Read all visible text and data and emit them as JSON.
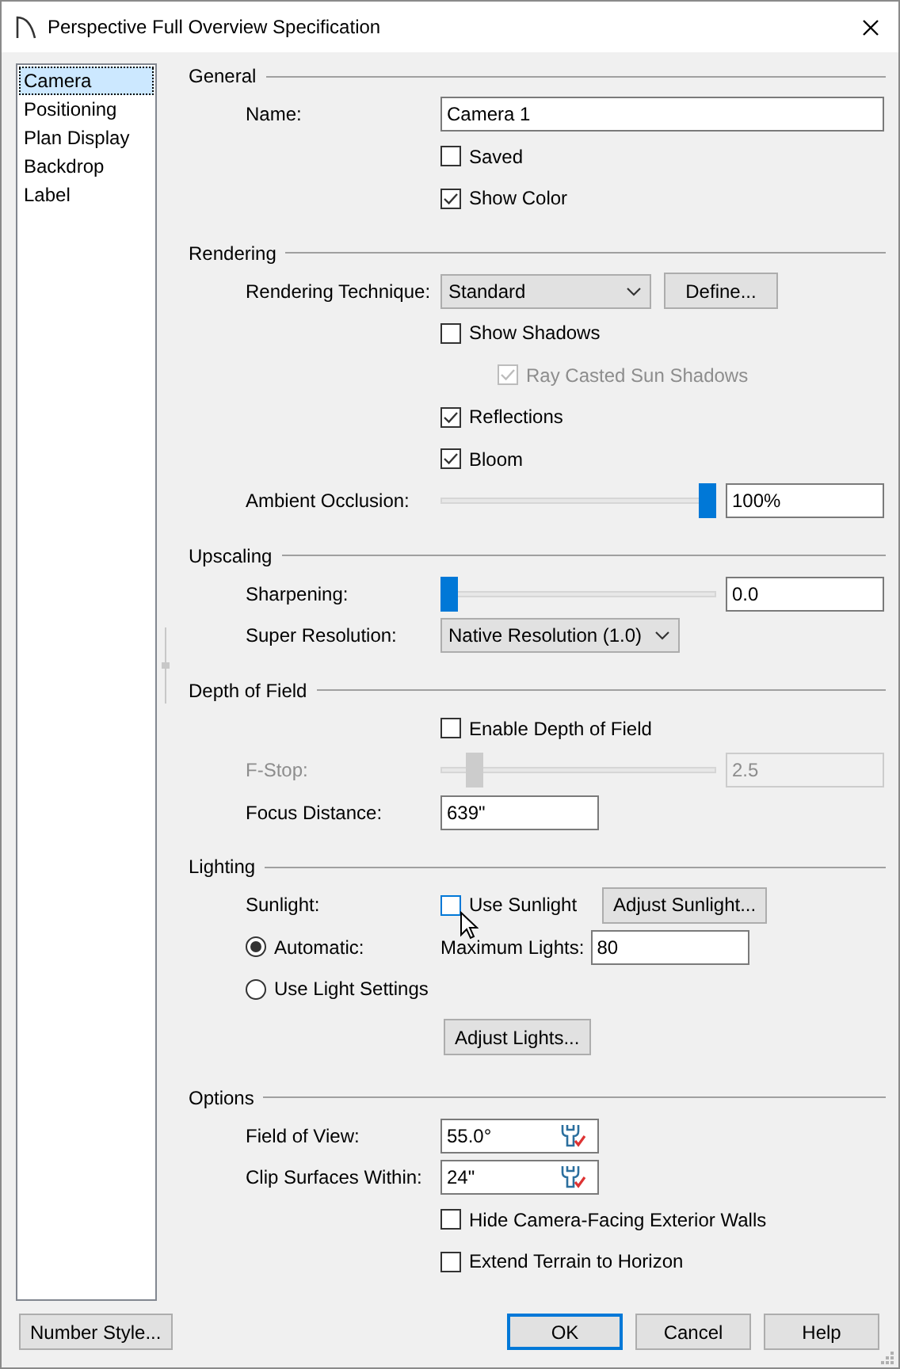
{
  "window": {
    "title": "Perspective Full Overview Specification"
  },
  "sidebar": {
    "items": [
      {
        "label": "Camera",
        "selected": true
      },
      {
        "label": "Positioning",
        "selected": false
      },
      {
        "label": "Plan Display",
        "selected": false
      },
      {
        "label": "Backdrop",
        "selected": false
      },
      {
        "label": "Label",
        "selected": false
      }
    ]
  },
  "sections": [
    {
      "heading": "General",
      "rows": [
        {
          "kind": "longfield",
          "label": "Name:",
          "value": "Camera 1"
        },
        {
          "kind": "checkbox",
          "label": "Saved",
          "checked": false
        },
        {
          "kind": "checkbox",
          "label": "Show Color",
          "checked": true
        }
      ]
    },
    {
      "heading": "Rendering",
      "rows": [
        {
          "kind": "select",
          "label": "Rendering Technique:",
          "value": "Standard",
          "button": "Define..."
        },
        {
          "kind": "checkbox",
          "label": "Show Shadows",
          "checked": false
        },
        {
          "kind": "subcheckbox",
          "label": "Ray Casted Sun Shadows",
          "checked": true,
          "disabled": true
        },
        {
          "kind": "checkbox",
          "label": "Reflections",
          "checked": true
        },
        {
          "kind": "checkbox",
          "label": "Bloom",
          "checked": true
        },
        {
          "kind": "slider",
          "label": "Ambient Occlusion:",
          "level": 1,
          "value": "100%"
        }
      ]
    },
    {
      "heading": "Upscaling",
      "rows": [
        {
          "kind": "slider",
          "label": "Sharpening:",
          "level": 0,
          "value": "0.0"
        },
        {
          "kind": "select",
          "label": "Super Resolution:",
          "value": "Native Resolution (1.0)"
        }
      ]
    },
    {
      "heading": "Depth of Field",
      "rows": [
        {
          "kind": "checkbox",
          "label": "Enable Depth of Field",
          "checked": false
        },
        {
          "kind": "slider",
          "label": "F-Stop:",
          "level": 0.1,
          "value": "2.5",
          "disabled": true
        },
        {
          "kind": "field",
          "label": "Focus Distance:",
          "value": "639\""
        }
      ]
    },
    {
      "heading": "Lighting",
      "rows": [
        {
          "kind": "sunlight",
          "label": "Sunlight:",
          "checkbox_label": "Use Sunlight",
          "checked": false,
          "hovered": true,
          "button": "Adjust Sunlight..."
        },
        {
          "kind": "radio",
          "label": "Automatic:",
          "selected": true,
          "field_label": "Maximum Lights:",
          "field_value": "80"
        },
        {
          "kind": "radio",
          "label": "Use Light Settings",
          "selected": false
        },
        {
          "kind": "button",
          "label": "Adjust Lights..."
        }
      ]
    },
    {
      "heading": "Options",
      "rows": [
        {
          "kind": "toolfield",
          "label": "Field of View:",
          "value": "55.0°"
        },
        {
          "kind": "toolfield",
          "label": "Clip Surfaces Within:",
          "value": "24\""
        },
        {
          "kind": "checkbox",
          "label": "Hide Camera-Facing Exterior Walls",
          "checked": false
        },
        {
          "kind": "checkbox",
          "label": "Extend Terrain to Horizon",
          "checked": false
        }
      ]
    }
  ],
  "footer": {
    "left_button": "Number Style...",
    "buttons": [
      {
        "label": "OK",
        "default": true
      },
      {
        "label": "Cancel",
        "default": false
      },
      {
        "label": "Help",
        "default": false
      }
    ]
  }
}
